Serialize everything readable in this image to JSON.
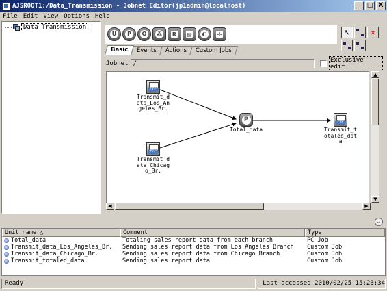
{
  "window": {
    "title": "AJSROOT1:/Data_Transmission - Jobnet Editor(jp1admin@localhost)",
    "minimize": "_",
    "maximize": "□",
    "close": "X"
  },
  "menu": [
    "File",
    "Edit",
    "View",
    "Options",
    "Help"
  ],
  "tree": {
    "root_label": "Data Transmission"
  },
  "toolbar": {
    "icons": [
      {
        "name": "pc-job-icon",
        "glyph": "U"
      },
      {
        "name": "jobnet-icon",
        "glyph": "P"
      },
      {
        "name": "queue-job-icon",
        "glyph": "Q"
      },
      {
        "name": "judgment-icon",
        "glyph": "⁂"
      },
      {
        "name": "event-job-icon",
        "glyph": "R"
      },
      {
        "name": "file-transfer-icon",
        "glyph": "▤"
      },
      {
        "name": "flow-control-icon",
        "glyph": "◐"
      },
      {
        "name": "custom-icon",
        "glyph": "✣"
      }
    ],
    "tabs": [
      "Basic",
      "Events",
      "Actions",
      "Custom Jobs"
    ],
    "active_tab": "Basic"
  },
  "right_tools": {
    "select_glyph": "↖",
    "delete_glyph": "✕"
  },
  "jobnet": {
    "label": "Jobnet",
    "value": "/",
    "exclusive_edit_label": "Exclusive edit"
  },
  "canvas": {
    "nodes": {
      "los_angeles": "Transmit_d\nata_Los_An\ngeles_Br.",
      "chicago": "Transmit_d\nata_Chicag\no_Br.",
      "total": "Total_data",
      "totaled": "Transmit_t\notaled_dat\na"
    },
    "ftp_badge": "FTP",
    "pc_badge": "P"
  },
  "unit_list": {
    "collapse_glyph": "⌄",
    "columns": [
      "Unit name △",
      "Comment",
      "Type"
    ],
    "rows": [
      {
        "name": "Total_data",
        "comment": "Totaling sales report data from each branch",
        "type": "PC Job"
      },
      {
        "name": "Transmit_data_Los_Angeles_Br.",
        "comment": "Sending sales report data from Los Angeles Branch",
        "type": "Custom Job"
      },
      {
        "name": "Transmit_data_Chicago_Br.",
        "comment": "Sending sales report data from Chicago Branch",
        "type": "Custom Job"
      },
      {
        "name": "Transmit_totaled_data",
        "comment": "Sending sales report data",
        "type": "Custom Job"
      }
    ]
  },
  "status": {
    "left": "Ready",
    "right": "Last accessed 2010/02/25 15:23:34"
  },
  "scroll": {
    "up": "▲",
    "down": "▼",
    "left": "◀",
    "right": "▶"
  }
}
